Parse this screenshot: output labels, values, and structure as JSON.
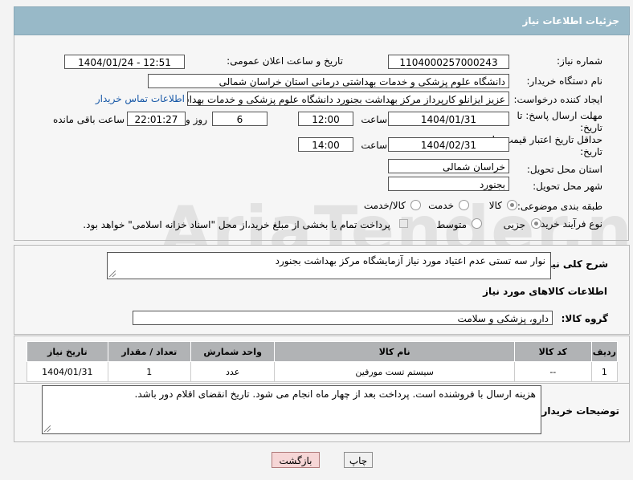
{
  "header": {
    "title": "جزئیات اطلاعات نیاز"
  },
  "form": {
    "need_number_label": "شماره نیاز:",
    "need_number": "1104000257000243",
    "announce_label": "تاریخ و ساعت اعلان عمومی:",
    "announce_value": "1404/01/24 - 12:51",
    "buyer_org_label": "نام دستگاه خریدار:",
    "buyer_org": "دانشگاه علوم پزشکی و خدمات بهداشتی درمانی استان خراسان شمالی",
    "requester_label": "ایجاد کننده درخواست:",
    "requester": "عزیز ایزانلو کارپرداز مرکز بهداشت بجنورد دانشگاه علوم پزشکی و خدمات بهداشت",
    "contact_link": "اطلاعات تماس خریدار",
    "reply_deadline_label": "مهلت ارسال پاسخ: تا تاریخ:",
    "reply_date": "1404/01/31",
    "time_label": "ساعت",
    "reply_time": "12:00",
    "days_value": "6",
    "days_label": "روز و",
    "remaining_time": "22:01:27",
    "remaining_label": "ساعت باقی مانده",
    "price_deadline_label": "حداقل تاریخ اعتبار قیمت: تا تاریخ:",
    "price_date": "1404/02/31",
    "price_time": "14:00",
    "province_label": "استان محل تحویل:",
    "province": "خراسان شمالی",
    "city_label": "شهر محل تحویل:",
    "city": "بجنورد",
    "category_label": "طبقه بندی موضوعی:",
    "category_options": [
      "کالا",
      "خدمت",
      "کالا/خدمت"
    ],
    "process_label": "نوع فرآیند خرید :",
    "process_options": [
      "جزیی",
      "متوسط"
    ],
    "payment_note": "پرداخت تمام یا بخشی از مبلغ خرید،از محل \"اسناد خزانه اسلامی\" خواهد بود."
  },
  "summary": {
    "label": "شرح کلی نیاز:",
    "text": "نوار سه تستی عدم اعتیاد مورد نیاز آزمایشگاه مرکز بهداشت بجنورد"
  },
  "goods": {
    "section_title": "اطلاعات کالاهای مورد نیاز",
    "group_label": "گروه کالا:",
    "group_value": "دارو، پزشکی و سلامت",
    "columns": [
      "ردیف",
      "کد کالا",
      "نام کالا",
      "واحد شمارش",
      "تعداد / مقدار",
      "تاریخ نیاز"
    ],
    "rows": [
      {
        "row": "1",
        "code": "--",
        "name": "سیستم تست مورفین",
        "unit": "عدد",
        "qty": "1",
        "date": "1404/01/31"
      }
    ]
  },
  "buyer_notes": {
    "label": "توضیحات خریدار:",
    "text": "هزینه ارسال با فروشنده است. پرداخت بعد از چهار ماه انجام می شود. تاریخ انقضای اقلام دور باشد."
  },
  "buttons": {
    "print": "چاپ",
    "back": "بازگشت"
  },
  "watermark": {
    "text": "AriaTender.net"
  },
  "colors": {
    "header_bg": "#98b9c8",
    "table_header_bg": "#b1b3b5",
    "link": "#1a5aa8"
  }
}
